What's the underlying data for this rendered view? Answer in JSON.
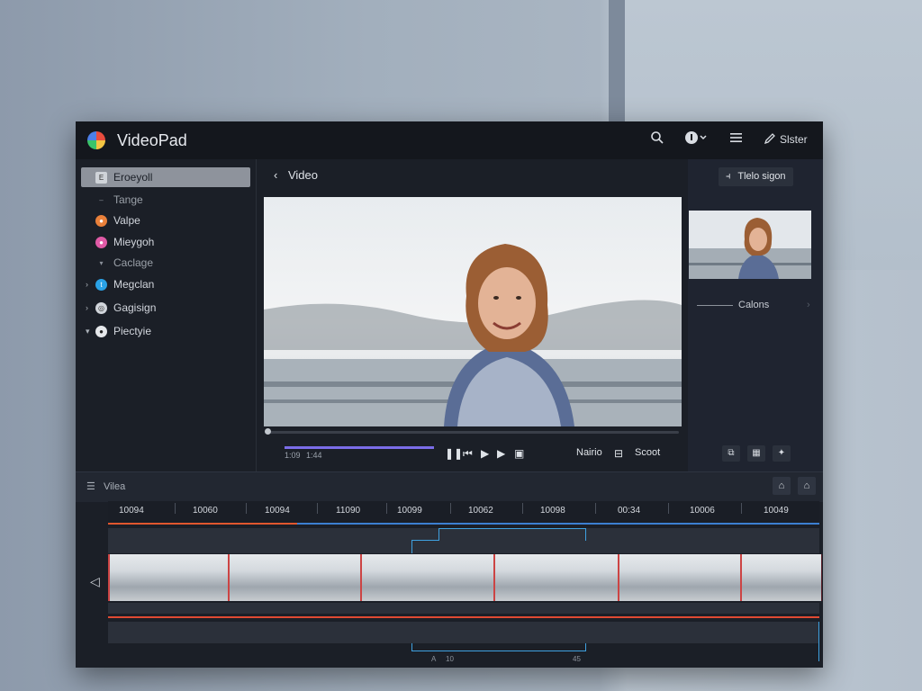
{
  "app": {
    "title": "VideoPad"
  },
  "toolbar": {
    "search_icon": "search-icon",
    "info_icon": "info-icon",
    "menu_icon": "menu-icon",
    "pen_icon": "pen-icon",
    "sider_label": "Slster"
  },
  "sidebar": {
    "items": [
      {
        "label": "Eroeyoll",
        "icon": "file-icon",
        "color": "#cfd3d9"
      },
      {
        "label": "Tange",
        "icon": "dash-icon",
        "color": "#8a9099"
      },
      {
        "label": "Valpe",
        "icon": "circle-icon",
        "color": "#e9803a"
      },
      {
        "label": "Mieygoh",
        "icon": "circle-icon",
        "color": "#e05aa6"
      },
      {
        "label": "Caclage",
        "icon": "caret-icon",
        "color": "#8a9099"
      },
      {
        "label": "Megclan",
        "icon": "twitter-icon",
        "color": "#2aa2e6"
      },
      {
        "label": "Gagisign",
        "icon": "globe-icon",
        "color": "#d1d5db"
      },
      {
        "label": "Piectyie",
        "icon": "circle-icon",
        "color": "#e6e8eb"
      }
    ]
  },
  "center": {
    "back_label": "Video"
  },
  "player": {
    "timecodes": [
      "1:09",
      "1:44"
    ],
    "progress": 1.0,
    "right_labels": [
      "Nairio",
      "Scoot"
    ]
  },
  "right_panel": {
    "top_button": "Tlelo sigon",
    "section_label": "Calons"
  },
  "timeline": {
    "title": "Vilea",
    "ruler": [
      "10094",
      "10060",
      "10094",
      "11090",
      "10099",
      "10062",
      "10098",
      "00:34",
      "10006",
      "10049"
    ],
    "footer": [
      "A",
      "10",
      "45"
    ]
  }
}
